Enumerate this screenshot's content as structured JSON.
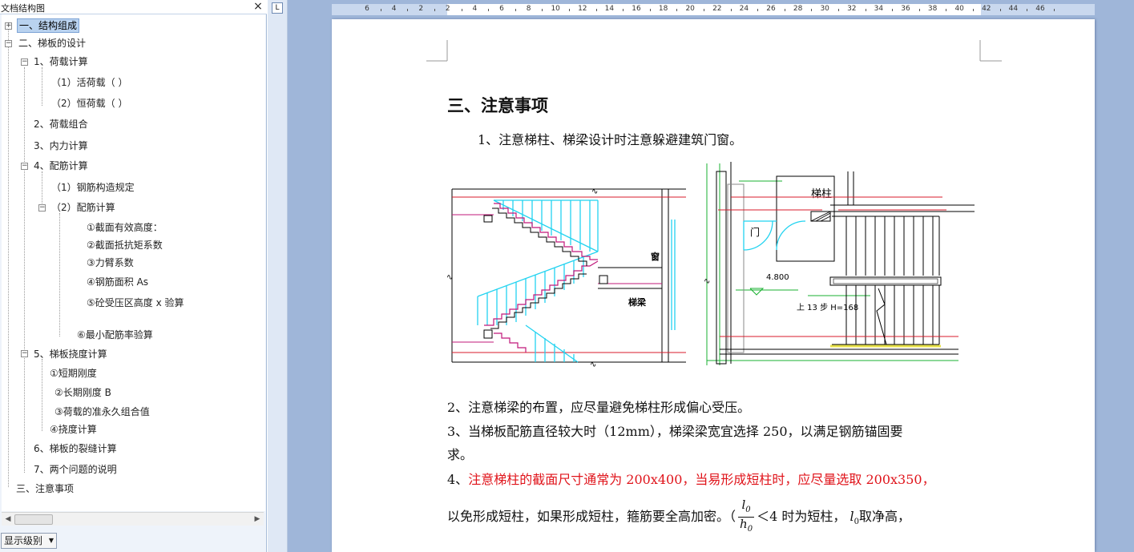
{
  "document_map": {
    "title": "文档结构图",
    "close_label": "×",
    "items": [
      {
        "label": "一、结构组成",
        "selected": true
      },
      {
        "label": "二、梯板的设计"
      },
      {
        "label": "1、荷载计算"
      },
      {
        "label": "（1）活荷载（ ）"
      },
      {
        "label": "（2）恒荷载（ ）"
      },
      {
        "label": "2、荷载组合"
      },
      {
        "label": "3、内力计算"
      },
      {
        "label": "4、配筋计算"
      },
      {
        "label": "（1）钢筋构造规定"
      },
      {
        "label": "（2）配筋计算"
      },
      {
        "label": "①截面有效高度："
      },
      {
        "label": "②截面抵抗矩系数"
      },
      {
        "label": "③力臂系数"
      },
      {
        "label": "④钢筋面积 As"
      },
      {
        "label": "⑤砼受压区高度 x 验算"
      },
      {
        "label": "⑥最小配筋率验算"
      },
      {
        "label": "5、梯板挠度计算"
      },
      {
        "label": "①短期刚度"
      },
      {
        "label": "②长期刚度 B"
      },
      {
        "label": "③荷载的准永久组合值"
      },
      {
        "label": "④挠度计算"
      },
      {
        "label": "6、梯板的裂缝计算"
      },
      {
        "label": "7、两个问题的说明"
      },
      {
        "label": "三、注意事项"
      }
    ],
    "show_level_label": "显示级别"
  },
  "ruler": {
    "numbers": [
      "6",
      "4",
      "2",
      "2",
      "4",
      "6",
      "8",
      "10",
      "12",
      "14",
      "16",
      "18",
      "20",
      "22",
      "24",
      "26",
      "28",
      "30",
      "32",
      "34",
      "36",
      "38",
      "40",
      "42",
      "44",
      "46"
    ]
  },
  "page": {
    "heading": "三、注意事项",
    "para1": "1、注意梯柱、梯梁设计时注意躲避建筑门窗。",
    "para2": "2、注意梯梁的布置，应尽量避免梯柱形成偏心受压。",
    "para3_line1": "3、当梯板配筋直径较大时（12mm），梯梁梁宽宜选择 250，以满足钢筋锚固要",
    "para3_line2": "求。",
    "para4_prefix": "4、",
    "para4_red": "注意梯柱的截面尺寸通常为 200x400，当易形成短柱时，应尽量选取 200x350，",
    "para5_before": "以免形成短柱，如果形成短柱，箍筋要全高加密。（",
    "frac_num": "l",
    "frac_num_sub": "0",
    "frac_den": "h",
    "frac_den_sub": "0",
    "para5_after": "＜4 时为短柱，",
    "para5_l0": "l",
    "para5_l0_sub": "0",
    "para5_end": "取净高，",
    "figure": {
      "window_label": "窗",
      "beam_label": "梯梁",
      "column_label": "梯柱",
      "door_label": "门",
      "elevation_label": "4.800",
      "steps_label": "上 13 步 H=168"
    }
  },
  "colors": {
    "accent_cyan": "#22d3f0",
    "line_red": "#d81b2b",
    "line_magenta": "#c0187a",
    "line_green": "#19b030",
    "line_yellow": "#e8e24a",
    "text_red": "#e0141b"
  }
}
